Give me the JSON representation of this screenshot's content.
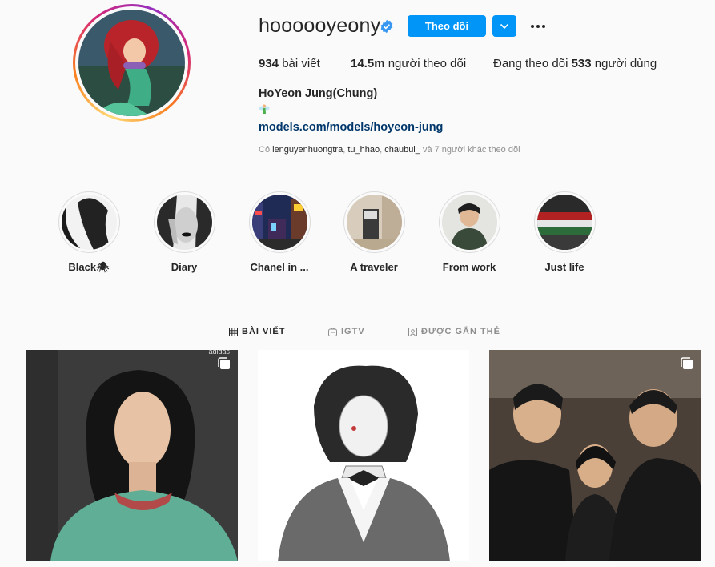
{
  "profile": {
    "username": "hoooooyeony",
    "follow_label": "Theo dõi",
    "fullname": "HoYeon Jung(Chung)",
    "link": "models.com/models/hoyeon-jung",
    "verified": true,
    "avatar_icon": "mermaid-avatar"
  },
  "stats": {
    "posts_count": "934",
    "posts_label": "bài viết",
    "followers_count": "14.5m",
    "followers_label": "người theo dõi",
    "following_prefix": "Đang theo dõi",
    "following_count": "533",
    "following_label": "người dùng"
  },
  "followed_by": {
    "prefix": "Có",
    "users": [
      "lenguyenhuongtra",
      "tu_hhao",
      "chaubui_"
    ],
    "suffix": "và 7 người khác theo dõi"
  },
  "highlights": [
    {
      "label": "Black🕷"
    },
    {
      "label": "Diary"
    },
    {
      "label": "Chanel in ..."
    },
    {
      "label": "A traveler"
    },
    {
      "label": "From work"
    },
    {
      "label": "Just life"
    }
  ],
  "tabs": [
    {
      "label": "BÀI VIẾT",
      "icon": "grid-icon",
      "active": true
    },
    {
      "label": "IGTV",
      "icon": "igtv-icon",
      "active": false
    },
    {
      "label": "ĐƯỢC GẮN THẺ",
      "icon": "tagged-icon",
      "active": false
    }
  ],
  "posts": [
    {
      "icon": "carousel-icon",
      "watermark": "adidas"
    },
    {
      "icon": "",
      "watermark": ""
    },
    {
      "icon": "carousel-icon",
      "watermark": ""
    }
  ],
  "colors": {
    "accent": "#0095f6",
    "link": "#00376b",
    "muted": "#8e8e8e",
    "text": "#262626"
  }
}
